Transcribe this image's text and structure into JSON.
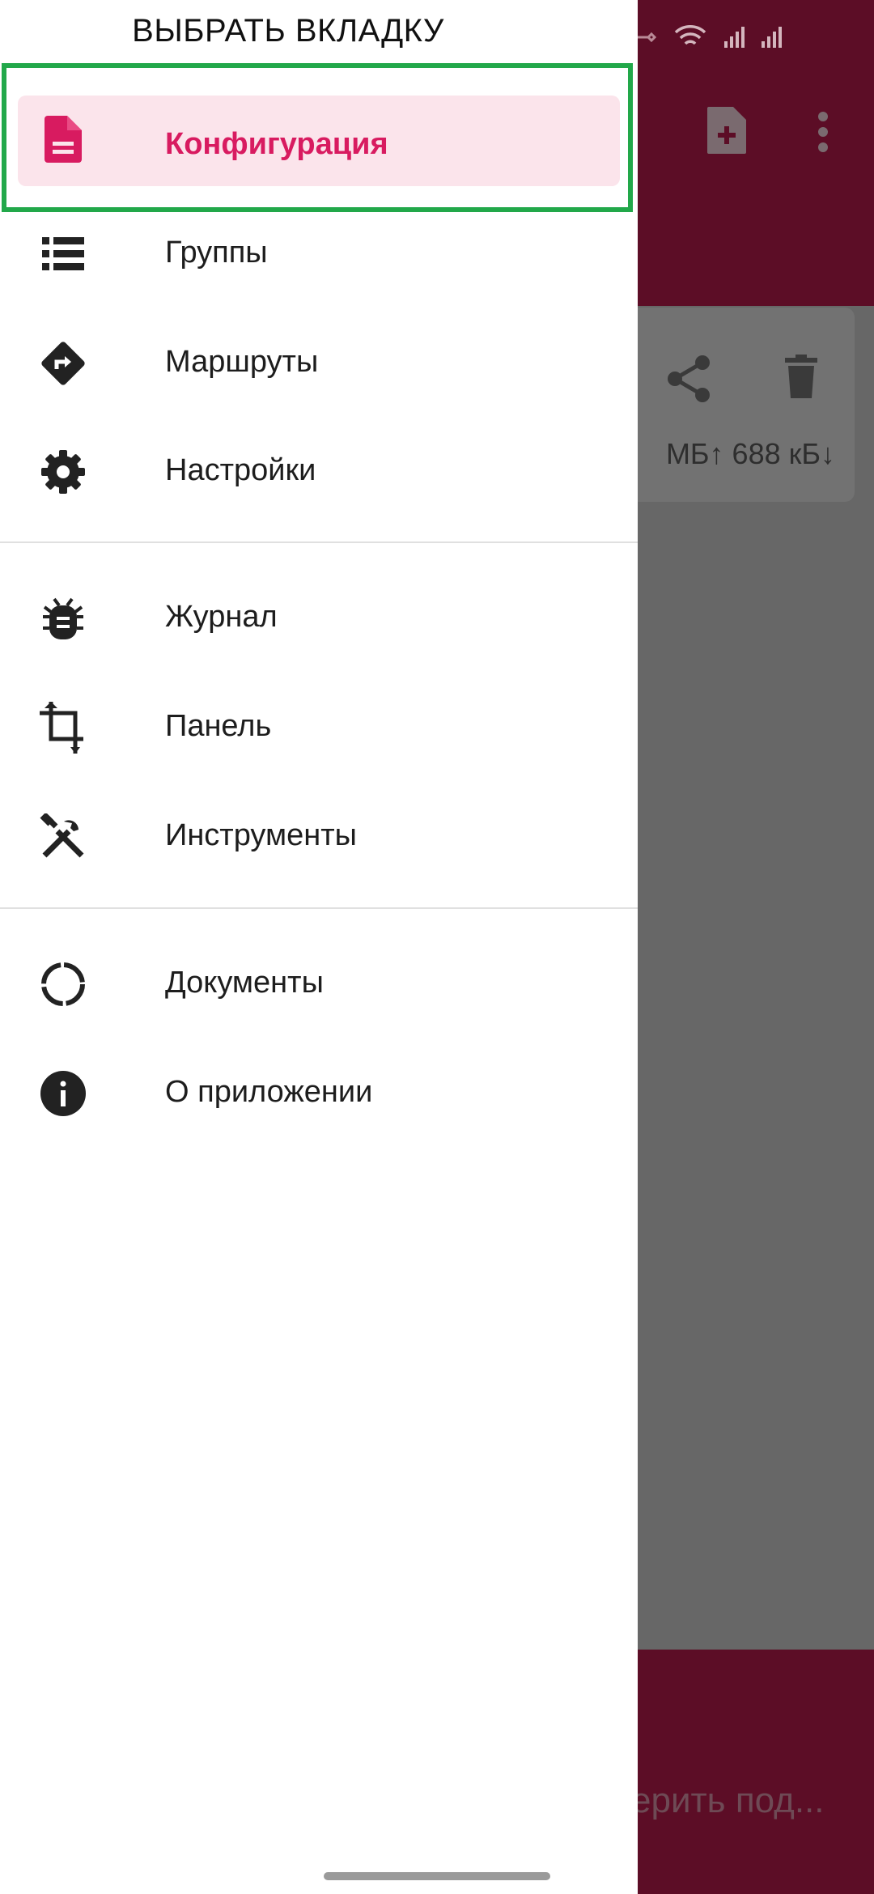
{
  "drawer": {
    "heading": "ВЫБРАТЬ ВКЛАДКУ",
    "items": [
      {
        "label": "Конфигурация",
        "icon": "document-icon",
        "active": true
      },
      {
        "label": "Группы",
        "icon": "list-icon"
      },
      {
        "label": "Маршруты",
        "icon": "directions-icon"
      },
      {
        "label": "Настройки",
        "icon": "gear-icon"
      },
      {
        "label": "Журнал",
        "icon": "bug-icon"
      },
      {
        "label": "Панель",
        "icon": "crop-icon"
      },
      {
        "label": "Инструменты",
        "icon": "tools-icon"
      },
      {
        "label": "Документы",
        "icon": "loading-ring-icon"
      },
      {
        "label": "О приложении",
        "icon": "info-icon"
      }
    ]
  },
  "background": {
    "stats_text": "МБ↑ 688 кБ↓",
    "bottom_text": "ерить под..."
  },
  "colors": {
    "accent": "#d81b60",
    "active_bg": "#fbe4eb",
    "app_bar": "#5c0d26",
    "highlight_frame": "#22a84a"
  }
}
